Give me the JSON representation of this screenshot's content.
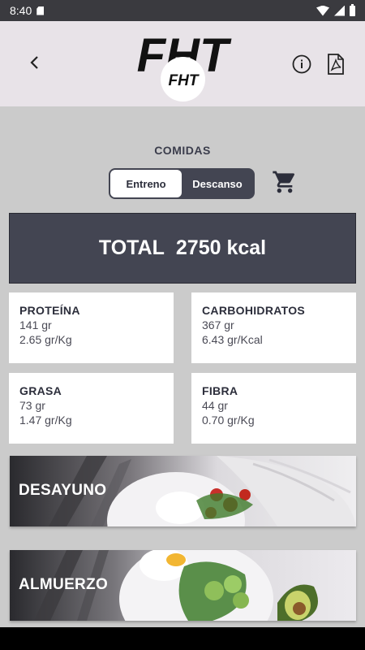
{
  "status_bar": {
    "time": "8:40"
  },
  "header": {
    "logo_text": "FHT",
    "back_icon": "back-arrow-icon",
    "info_icon": "info-icon",
    "pdf_icon": "pdf-icon"
  },
  "section": {
    "title": "COMIDAS"
  },
  "toggle": {
    "options": [
      "Entreno",
      "Descanso"
    ],
    "selected": "Entreno"
  },
  "cart_icon": "cart-icon",
  "total": {
    "label": "TOTAL",
    "value": "2750 kcal"
  },
  "macros": [
    {
      "name": "PROTEÍNA",
      "amount": "141 gr",
      "ratio": "2.65 gr/Kg"
    },
    {
      "name": "CARBOHIDRATOS",
      "amount": "367 gr",
      "ratio": "6.43 gr/Kcal"
    },
    {
      "name": "GRASA",
      "amount": "73 gr",
      "ratio": "1.47 gr/Kg"
    },
    {
      "name": "FIBRA",
      "amount": "44 gr",
      "ratio": "0.70 gr/Kg"
    }
  ],
  "meals": [
    {
      "label": "DESAYUNO"
    },
    {
      "label": "ALMUERZO"
    }
  ],
  "colors": {
    "primary_dark": "#434552",
    "page_bg": "#cbcbcb",
    "header_bg": "#e8e3e8",
    "text_dark": "#2c2e3b"
  }
}
